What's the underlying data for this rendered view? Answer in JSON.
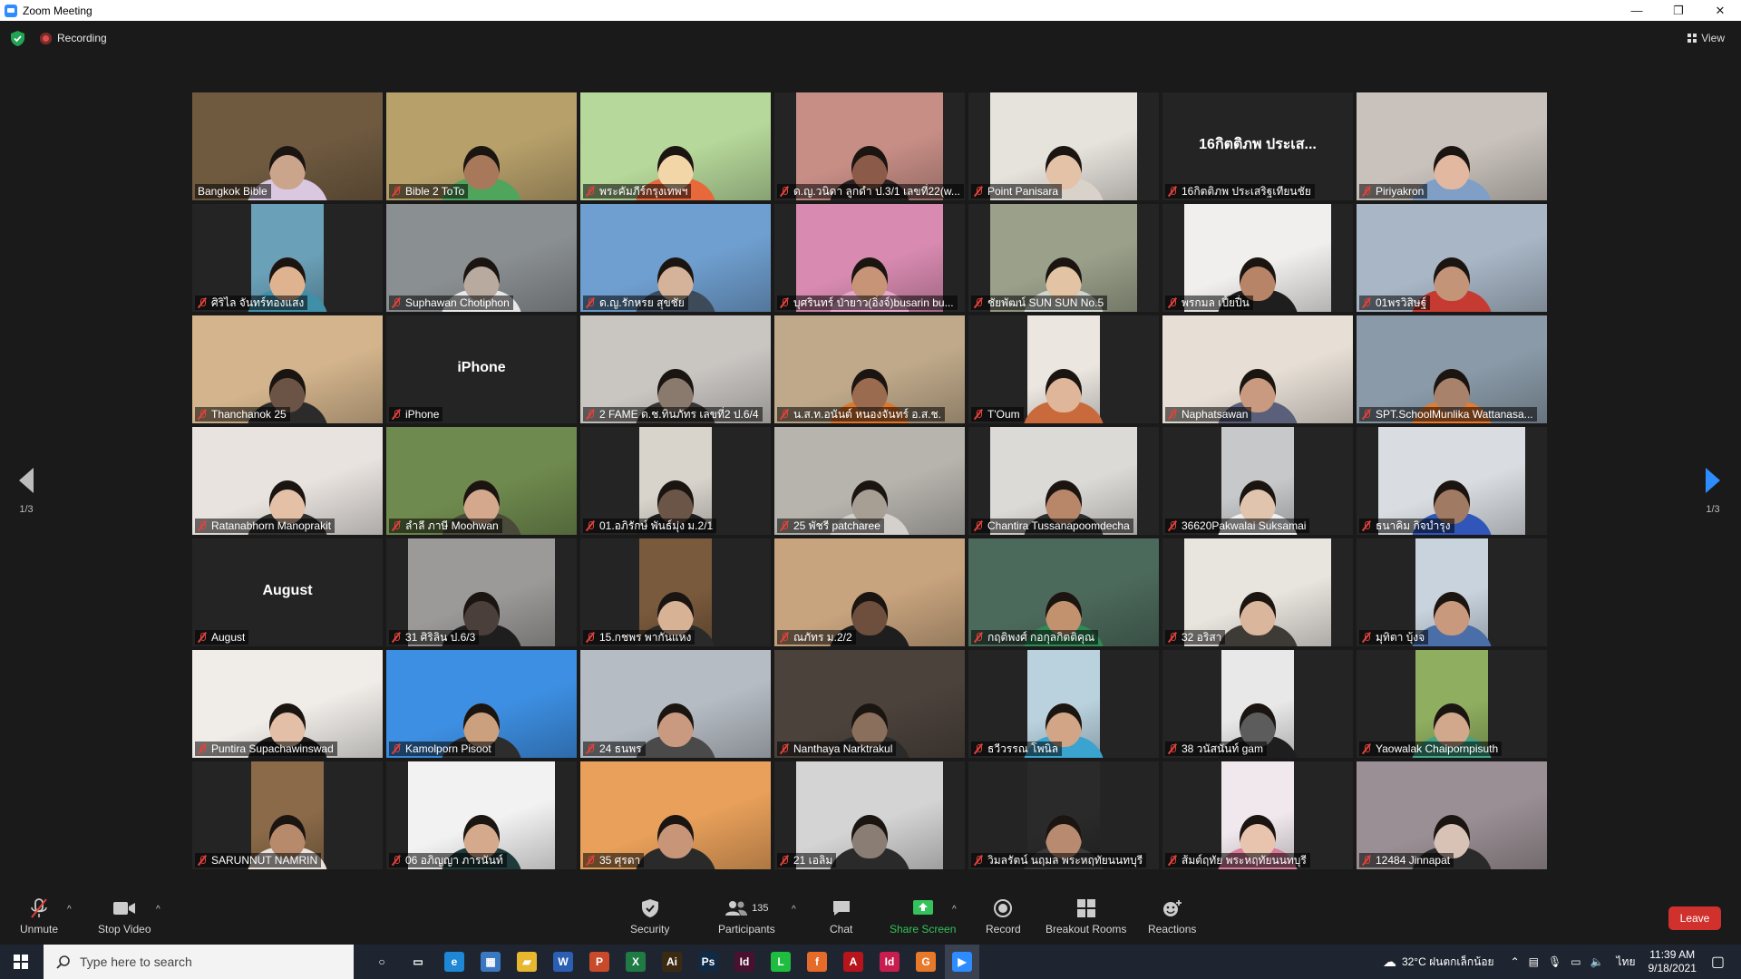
{
  "window": {
    "title": "Zoom Meeting"
  },
  "topbar": {
    "recording_label": "Recording",
    "view_label": "View"
  },
  "pager": {
    "left": "1/3",
    "right": "1/3"
  },
  "participants": [
    {
      "name": "Bangkok Bible",
      "kind": "full",
      "bg": "#6f5a40",
      "skin": "#caa58c",
      "shirt": "#d9c8e0",
      "active": true
    },
    {
      "name": "Bible 2 ToTo",
      "kind": "full",
      "bg": "#b7a06a",
      "skin": "#a8785a",
      "shirt": "#4ea55b"
    },
    {
      "name": "พระคัมภีร์กรุงเทพฯ",
      "kind": "full",
      "bg": "#b6d89a",
      "skin": "#f2d6a8",
      "shirt": "#e7683b"
    },
    {
      "name": "ด.ญ.วนิดา ลูกดำ ป.3/1 เลขที่22(w...",
      "kind": "mid",
      "bg": "#c78e86",
      "skin": "#8c5a48",
      "shirt": "#2a2222"
    },
    {
      "name": "Point Panisara",
      "kind": "mid",
      "bg": "#e6e2dc",
      "skin": "#e4c2a8",
      "shirt": "#d9d2cb"
    },
    {
      "name": "16กิตติภพ ประเสริฐเทียนชัย",
      "kind": "name",
      "bigname": "16กิตติภพ ประเส..."
    },
    {
      "name": "Piriyakron",
      "kind": "full",
      "bg": "#c9c2bc",
      "skin": "#e2b8a0",
      "shirt": "#7f9fc7"
    },
    {
      "name": "ศิริไล จันทร์ทองแสง",
      "kind": "narrow",
      "bg": "#6aa0b8",
      "skin": "#e0b390",
      "shirt": "#3f8fa8"
    },
    {
      "name": "Suphawan Chotiphon",
      "kind": "full",
      "bg": "#8a8f92",
      "skin": "#b9aaa0",
      "shirt": "#e8e8e8"
    },
    {
      "name": "ด.ญ.รักหรย สุขชัย",
      "kind": "full",
      "bg": "#6f9fd0",
      "skin": "#d5b39b",
      "shirt": "#3d4a57"
    },
    {
      "name": "บุศรินทร์ ป่ายาว(อิ่งจ์)busarin bu...",
      "kind": "mid",
      "bg": "#d88ab0",
      "skin": "#c89477",
      "shirt": "#e8a8c9"
    },
    {
      "name": "ชัยพัฒน์ SUN SUN No.5",
      "kind": "mid",
      "bg": "#9aa08a",
      "skin": "#e2c4a5",
      "shirt": "#cfd6cf"
    },
    {
      "name": "พรกมล เปี้ยปื่น",
      "kind": "mid",
      "bg": "#f0efee",
      "skin": "#b88468",
      "shirt": "#1e1e1e"
    },
    {
      "name": "01พรวิสิษฐ์",
      "kind": "full",
      "bg": "#a8b6c6",
      "skin": "#c49478",
      "shirt": "#c53b32"
    },
    {
      "name": "Thanchanok 25",
      "kind": "full",
      "bg": "#d3b48c",
      "skin": "#6b5446",
      "shirt": "#2b2b2b"
    },
    {
      "name": "iPhone",
      "kind": "name",
      "bigname": "iPhone"
    },
    {
      "name": "2 FAME ด.ช.ทินภัทร เลขที่2 ป.6/4",
      "kind": "full",
      "bg": "#c9c6c2",
      "skin": "#8a7a6e",
      "shirt": "#3a3532"
    },
    {
      "name": "น.ส.ท.อนันต์ หนองจันทร์ อ.ส.ช.",
      "kind": "full",
      "bg": "#bfa98a",
      "skin": "#9a6b4e",
      "shirt": "#e1762b"
    },
    {
      "name": "T'Oum",
      "kind": "narrow",
      "bg": "#ebe6e0",
      "skin": "#e0b69a",
      "shirt": "#c96a3d"
    },
    {
      "name": "Naphatsawan",
      "kind": "full",
      "bg": "#e7dfd6",
      "skin": "#c99a7f",
      "shirt": "#5a5f7a"
    },
    {
      "name": "SPT.SchoolMunlika Wattanasa...",
      "kind": "full",
      "bg": "#8a9aa8",
      "skin": "#a8826a",
      "shirt": "#e87a2e"
    },
    {
      "name": "Ratanabhorn Manoprakit",
      "kind": "full",
      "bg": "#e8e3df",
      "skin": "#e4c0a6",
      "shirt": "#2f2f2f"
    },
    {
      "name": "ลำลี ภาษี Moohwan",
      "kind": "full",
      "bg": "#6f8a4e",
      "skin": "#d4a88c",
      "shirt": "#4a4a3a"
    },
    {
      "name": "01.อภิรักษ์ พันธ์มุ่ง ม.2/1",
      "kind": "narrow",
      "bg": "#d8d4cc",
      "skin": "#6b5546",
      "shirt": "#1e1e1e"
    },
    {
      "name": "25 พัชรี patcharee",
      "kind": "full",
      "bg": "#b7b4ae",
      "skin": "#a79e94",
      "shirt": "#d4d1cc"
    },
    {
      "name": "Chantira Tussanapoomdecha",
      "kind": "mid",
      "bg": "#dcdad6",
      "skin": "#b8876a",
      "shirt": "#2f2f2f"
    },
    {
      "name": "36620Pakwalai Suksamai",
      "kind": "narrow",
      "bg": "#c7c8ca",
      "skin": "#e0c4ae",
      "shirt": "#f0f0f0"
    },
    {
      "name": "ธนาคิม กิจบำรุง",
      "kind": "mid",
      "bg": "#d9dde2",
      "skin": "#a07a62",
      "shirt": "#2f56b8"
    },
    {
      "name": "August",
      "kind": "name",
      "bigname": "August"
    },
    {
      "name": "31 ศิริลิน ป.6/3",
      "kind": "mid",
      "bg": "#9b9a99",
      "skin": "#4a3f3a",
      "shirt": "#1e1e1e"
    },
    {
      "name": "15.กชพร พากันแหง",
      "kind": "narrow",
      "bg": "#7a5a3c",
      "skin": "#d8b295",
      "shirt": "#2a2a2a"
    },
    {
      "name": "ณภัทร ม.2/2",
      "kind": "full",
      "bg": "#c8a47e",
      "skin": "#6e4f3e",
      "shirt": "#1e1e1e"
    },
    {
      "name": "กฤติพงศ์ กอกุลกิตติคุณ",
      "kind": "full",
      "bg": "#4c6a5c",
      "skin": "#c2926f",
      "shirt": "#2f8a56"
    },
    {
      "name": "32 อริสา",
      "kind": "mid",
      "bg": "#e8e4de",
      "skin": "#d9b69c",
      "shirt": "#3e3a36"
    },
    {
      "name": "มุทิตา บุ้งจ",
      "kind": "narrow",
      "bg": "#c8d3de",
      "skin": "#c8997c",
      "shirt": "#4a6ea8"
    },
    {
      "name": "Puntira Supachawinswad",
      "kind": "full",
      "bg": "#f0ede9",
      "skin": "#e2bfa6",
      "shirt": "#1e1e1e"
    },
    {
      "name": "Kamolporn Pisoot",
      "kind": "full",
      "bg": "#3d8fe3",
      "skin": "#caa07e",
      "shirt": "#2d2d2d"
    },
    {
      "name": "24 ธนพร",
      "kind": "full",
      "bg": "#b6bcc4",
      "skin": "#c99a80",
      "shirt": "#4a4a4a"
    },
    {
      "name": "Nanthaya Narktrakul",
      "kind": "full",
      "bg": "#4c423c",
      "skin": "#8a6f5c",
      "shirt": "#2a2a2a"
    },
    {
      "name": "ธวีวรรณ โพนิล",
      "kind": "narrow",
      "bg": "#b9d2de",
      "skin": "#d2a586",
      "shirt": "#3aa3d0"
    },
    {
      "name": "38 วนัสนันท์ gam",
      "kind": "narrow",
      "bg": "#e8e8e8",
      "skin": "#5c5c5c",
      "shirt": "#1e1e1e"
    },
    {
      "name": "Yaowalak Chaipornpisuth",
      "kind": "narrow",
      "bg": "#8fae5f",
      "skin": "#d2a88c",
      "shirt": "#3fa487"
    },
    {
      "name": "SARUNNUT NAMRIN",
      "kind": "narrow",
      "bg": "#8a6a48",
      "skin": "#b78a6c",
      "shirt": "#e9e3db"
    },
    {
      "name": "06 อภิญญา ภารนันท์",
      "kind": "mid",
      "bg": "#f2f2f2",
      "skin": "#d5aa8c",
      "shirt": "#1f3a3a"
    },
    {
      "name": "35 ศุรดา",
      "kind": "full",
      "bg": "#e8a05a",
      "skin": "#c99578",
      "shirt": "#2a2a2a"
    },
    {
      "name": "21 เอลิม",
      "kind": "mid",
      "bg": "#d4d4d4",
      "skin": "#8a7e74",
      "shirt": "#2a2a2a"
    },
    {
      "name": "วิมลรัตน์ นฤมล พระหฤทัยนนทบุรี",
      "kind": "narrow",
      "bg": "#2a2a2a",
      "skin": "#b88a70",
      "shirt": "#3a3a3a"
    },
    {
      "name": "ส้มต์ฤทัย พระหฤทัยนนทบุรี",
      "kind": "narrow",
      "bg": "#f0e8ec",
      "skin": "#e8c4ae",
      "shirt": "#d87a9a"
    },
    {
      "name": "12484 Jinnapat",
      "kind": "full",
      "bg": "#9a8f94",
      "skin": "#d8c2b6",
      "shirt": "#2a2a2a"
    }
  ],
  "toolbar": {
    "unmute": "Unmute",
    "stop_video": "Stop Video",
    "security": "Security",
    "participants": "Participants",
    "participants_count": "135",
    "chat": "Chat",
    "share_screen": "Share Screen",
    "record": "Record",
    "breakout": "Breakout Rooms",
    "reactions": "Reactions",
    "leave": "Leave"
  },
  "taskbar": {
    "search_placeholder": "Type here to search",
    "weather": "32°C ฝนตกเล็กน้อย",
    "lang": "ไทย",
    "time": "11:39 AM",
    "date": "9/18/2021",
    "apps": [
      {
        "name": "cortana-circle-icon",
        "color": "#1f2530",
        "text": "○"
      },
      {
        "name": "task-view-icon",
        "color": "#1f2530",
        "text": "▭"
      },
      {
        "name": "edge-icon",
        "color": "#1e88d6",
        "text": "e"
      },
      {
        "name": "calculator-icon",
        "color": "#3a78c2",
        "text": "▦"
      },
      {
        "name": "file-explorer-icon",
        "color": "#e8b730",
        "text": "▰"
      },
      {
        "name": "word-icon",
        "color": "#2b5fb4",
        "text": "W"
      },
      {
        "name": "powerpoint-icon",
        "color": "#c94a2b",
        "text": "P"
      },
      {
        "name": "excel-icon",
        "color": "#1f7a43",
        "text": "X"
      },
      {
        "name": "illustrator-icon",
        "color": "#3b2a12",
        "text": "Ai"
      },
      {
        "name": "photoshop-icon",
        "color": "#0f2a45",
        "text": "Ps"
      },
      {
        "name": "indesign-icon",
        "color": "#4a1030",
        "text": "Id"
      },
      {
        "name": "line-icon",
        "color": "#1fbd3f",
        "text": "L"
      },
      {
        "name": "firefox-icon",
        "color": "#e66a2a",
        "text": "f"
      },
      {
        "name": "acrobat-icon",
        "color": "#b8141b",
        "text": "A"
      },
      {
        "name": "indesign2-icon",
        "color": "#c81e4f",
        "text": "Id"
      },
      {
        "name": "grammarly-icon",
        "color": "#e8782a",
        "text": "G"
      },
      {
        "name": "zoom-icon",
        "color": "#2d8cff",
        "text": "▶"
      }
    ]
  }
}
